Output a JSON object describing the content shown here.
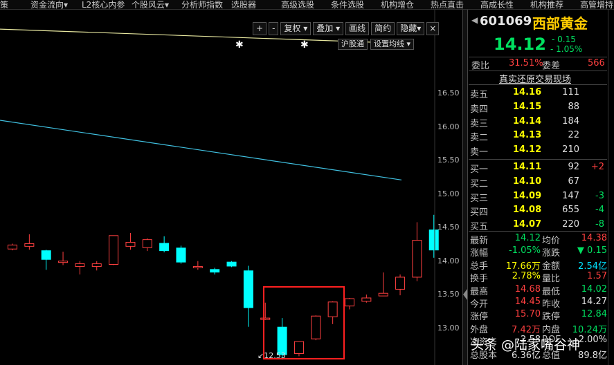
{
  "top_menu": [
    "策",
    "资金流向▾",
    "L2核心内参",
    "个股风云▾",
    "分析师指数",
    "选股器",
    "高级选股",
    "条件选股",
    "机构增仓",
    "热点直击",
    "高成长性",
    "机构推荐",
    "高管增持"
  ],
  "toolbar": {
    "plus": "+",
    "minus": "-",
    "fuquan": "复权",
    "diejia": "叠加",
    "hualine": "画线",
    "simple": "简约",
    "hide": "隐藏",
    "hu_gutong": "沪股通",
    "set_ma": "设置均线"
  },
  "chart": {
    "price_axis": [
      "16.50",
      "16.00",
      "15.50",
      "15.00",
      "14.50",
      "14.00",
      "13.50",
      "13.00"
    ],
    "low_marker": "12.53",
    "colors": {
      "up": "#ff4040",
      "down": "#00ffff",
      "ma_yellow": "#e8e8a0",
      "ma_cyan": "#40c0e0",
      "box": "#ff2020"
    }
  },
  "chart_data": {
    "type": "candlestick",
    "ylim": [
      12.45,
      17.75
    ],
    "ma_lines": [
      {
        "name": "",
        "color": "#e8e8a0",
        "values": [
          17.46,
          17.25
        ]
      },
      {
        "name": "",
        "color": "#40c0e0",
        "values": [
          16.1,
          15.21
        ]
      }
    ],
    "candles": [
      {
        "o": 14.18,
        "c": 14.24,
        "h": 14.26,
        "l": 14.16,
        "dir": "up"
      },
      {
        "o": 14.22,
        "c": 14.26,
        "h": 14.4,
        "l": 14.17,
        "dir": "up"
      },
      {
        "o": 14.16,
        "c": 14.02,
        "h": 14.17,
        "l": 13.87,
        "dir": "down"
      },
      {
        "o": 13.98,
        "c": 14.0,
        "h": 14.14,
        "l": 13.94,
        "dir": "up"
      },
      {
        "o": 13.92,
        "c": 13.96,
        "h": 14.0,
        "l": 13.8,
        "dir": "up"
      },
      {
        "o": 13.92,
        "c": 13.96,
        "h": 14.0,
        "l": 13.86,
        "dir": "up"
      },
      {
        "o": 13.95,
        "c": 14.38,
        "h": 14.38,
        "l": 13.94,
        "dir": "up"
      },
      {
        "o": 14.22,
        "c": 14.28,
        "h": 14.42,
        "l": 14.17,
        "dir": "up"
      },
      {
        "o": 14.2,
        "c": 14.32,
        "h": 14.34,
        "l": 14.15,
        "dir": "up"
      },
      {
        "o": 14.27,
        "c": 14.15,
        "h": 14.37,
        "l": 14.13,
        "dir": "down"
      },
      {
        "o": 14.2,
        "c": 13.98,
        "h": 14.23,
        "l": 13.96,
        "dir": "down"
      },
      {
        "o": 13.92,
        "c": 13.92,
        "h": 14.0,
        "l": 13.87,
        "dir": "flat"
      },
      {
        "o": 13.88,
        "c": 13.83,
        "h": 13.9,
        "l": 13.8,
        "dir": "down"
      },
      {
        "o": 13.99,
        "c": 13.92,
        "h": 14.0,
        "l": 13.91,
        "dir": "down"
      },
      {
        "o": 13.86,
        "c": 13.3,
        "h": 13.93,
        "l": 13.02,
        "dir": "down"
      },
      {
        "o": 13.13,
        "c": 13.15,
        "h": 13.38,
        "l": 13.12,
        "dir": "flat"
      },
      {
        "o": 13.02,
        "c": 12.6,
        "h": 13.15,
        "l": 12.53,
        "dir": "down"
      },
      {
        "o": 12.62,
        "c": 12.8,
        "h": 12.8,
        "l": 12.58,
        "dir": "up"
      },
      {
        "o": 12.84,
        "c": 13.18,
        "h": 13.19,
        "l": 12.82,
        "dir": "up"
      },
      {
        "o": 13.17,
        "c": 13.39,
        "h": 13.4,
        "l": 13.06,
        "dir": "up"
      },
      {
        "o": 13.33,
        "c": 13.44,
        "h": 13.45,
        "l": 13.28,
        "dir": "up"
      },
      {
        "o": 13.4,
        "c": 13.45,
        "h": 13.5,
        "l": 13.38,
        "dir": "up"
      },
      {
        "o": 13.48,
        "c": 13.52,
        "h": 13.83,
        "l": 13.48,
        "dir": "up"
      },
      {
        "o": 13.58,
        "c": 13.76,
        "h": 13.8,
        "l": 13.49,
        "dir": "up"
      },
      {
        "o": 13.76,
        "c": 14.31,
        "h": 14.58,
        "l": 13.7,
        "dir": "up"
      },
      {
        "o": 14.47,
        "c": 14.16,
        "h": 14.69,
        "l": 14.05,
        "dir": "down"
      }
    ]
  },
  "quote": {
    "code": "601069",
    "name": "西部黄金",
    "price": "14.12",
    "change": "- 0.15",
    "change_pct": "- 1.05%",
    "weibi_label": "委比",
    "weibi": "31.51%",
    "weicha_label": "委差",
    "weicha": "566",
    "restore_title": "真实还原交易现场",
    "asks": [
      {
        "label": "卖五",
        "price": "14.16",
        "vol": "111",
        "chg": ""
      },
      {
        "label": "卖四",
        "price": "14.15",
        "vol": "88",
        "chg": ""
      },
      {
        "label": "卖三",
        "price": "14.14",
        "vol": "184",
        "chg": ""
      },
      {
        "label": "卖二",
        "price": "14.13",
        "vol": "22",
        "chg": ""
      },
      {
        "label": "卖一",
        "price": "14.12",
        "vol": "210",
        "chg": ""
      }
    ],
    "bids": [
      {
        "label": "买一",
        "price": "14.11",
        "vol": "92",
        "chg": "+2"
      },
      {
        "label": "买二",
        "price": "14.10",
        "vol": "67",
        "chg": ""
      },
      {
        "label": "买三",
        "price": "14.09",
        "vol": "147",
        "chg": "-3"
      },
      {
        "label": "买四",
        "price": "14.08",
        "vol": "655",
        "chg": "-4"
      },
      {
        "label": "买五",
        "price": "14.07",
        "vol": "220",
        "chg": "-8"
      }
    ],
    "stats": [
      {
        "l1": "最新",
        "v1": "14.12",
        "c1": "green",
        "l2": "均价",
        "v2": "14.38",
        "c2": "red"
      },
      {
        "l1": "涨幅",
        "v1": "-1.05%",
        "c1": "green",
        "l2": "涨跌",
        "v2": "▼ 0.15",
        "c2": "green"
      },
      {
        "l1": "总手",
        "v1": "17.66万",
        "c1": "yellow",
        "l2": "金额",
        "v2": "2.54亿",
        "c2": "cyan"
      },
      {
        "l1": "换手",
        "v1": "2.78%",
        "c1": "yellow",
        "l2": "量比",
        "v2": "1.57",
        "c2": "red"
      },
      {
        "l1": "最高",
        "v1": "14.68",
        "c1": "red",
        "l2": "最低",
        "v2": "14.02",
        "c2": "green"
      },
      {
        "l1": "今开",
        "v1": "14.45",
        "c1": "red",
        "l2": "昨收",
        "v2": "14.27",
        "c2": "white"
      },
      {
        "l1": "涨停",
        "v1": "15.70",
        "c1": "red",
        "l2": "跌停",
        "v2": "12.84",
        "c2": "green"
      },
      {
        "l1": "外盘",
        "v1": "7.42万",
        "c1": "red",
        "l2": "内盘",
        "v2": "10.24万",
        "c2": "green"
      },
      {
        "l1": "净资产",
        "v1": "2.58",
        "c1": "white",
        "l2": "ROE",
        "v2": "-2.00%",
        "c2": "white"
      },
      {
        "l1": "总股本",
        "v1": "6.36亿",
        "c1": "white",
        "l2": "总值",
        "v2": "89.8亿",
        "c2": "white"
      }
    ]
  },
  "watermark": {
    "text": "头条 @陆家嘴谷神",
    "icon": "camera-icon"
  }
}
